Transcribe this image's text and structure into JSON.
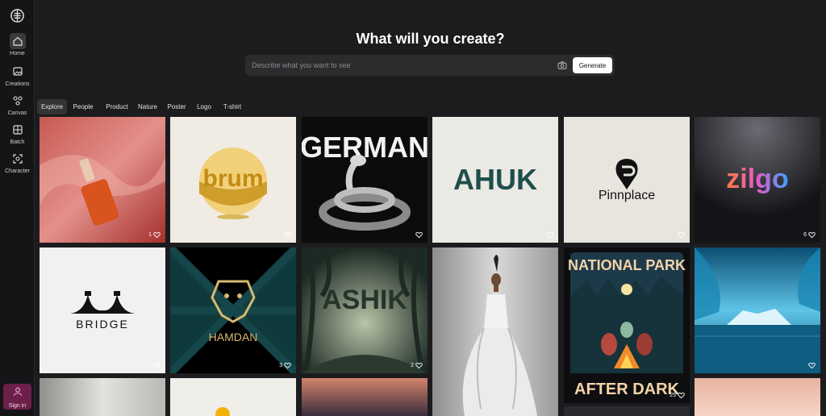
{
  "app": {
    "nav": [
      {
        "label": "Home",
        "icon": "home-icon"
      },
      {
        "label": "Creations",
        "icon": "images-icon"
      },
      {
        "label": "Canvas",
        "icon": "canvas-icon"
      },
      {
        "label": "Batch",
        "icon": "batch-icon"
      },
      {
        "label": "Character",
        "icon": "character-icon"
      }
    ],
    "signin_label": "Sign in"
  },
  "hero": {
    "title": "What will you create?",
    "search_placeholder": "Describe what you want to see",
    "generate_label": "Generate"
  },
  "tabs": [
    "Explore",
    "People",
    "Product",
    "Nature",
    "Poster",
    "Logo",
    "T-shirt"
  ],
  "grid": {
    "row1": [
      {
        "name": "serum-bottle",
        "likes": "1"
      },
      {
        "name": "brum-logo",
        "text": "brum",
        "likes": ""
      },
      {
        "name": "german-snake",
        "text": "GERMAN",
        "likes": ""
      },
      {
        "name": "ahuk-logo",
        "text": "AHUK",
        "likes": ""
      },
      {
        "name": "pinnplace-logo",
        "text": "Pinnplace",
        "likes": ""
      },
      {
        "name": "zilgo-logo",
        "text": "zilgo",
        "likes": "6"
      }
    ],
    "row2": [
      {
        "name": "bridge-logo",
        "text": "BRIDGE",
        "likes": ""
      },
      {
        "name": "hamdan-logo",
        "text": "HAMDAN",
        "likes": "3"
      },
      {
        "name": "ashik-forest",
        "text": "ASHIK",
        "likes": "2"
      },
      {
        "name": "fashion-dress",
        "likes": ""
      },
      {
        "name": "national-park-poster",
        "text_top": "NATIONAL PARK",
        "text_bottom": "AFTER DARK",
        "likes": "25"
      },
      {
        "name": "ice-cave",
        "likes": ""
      }
    ]
  }
}
